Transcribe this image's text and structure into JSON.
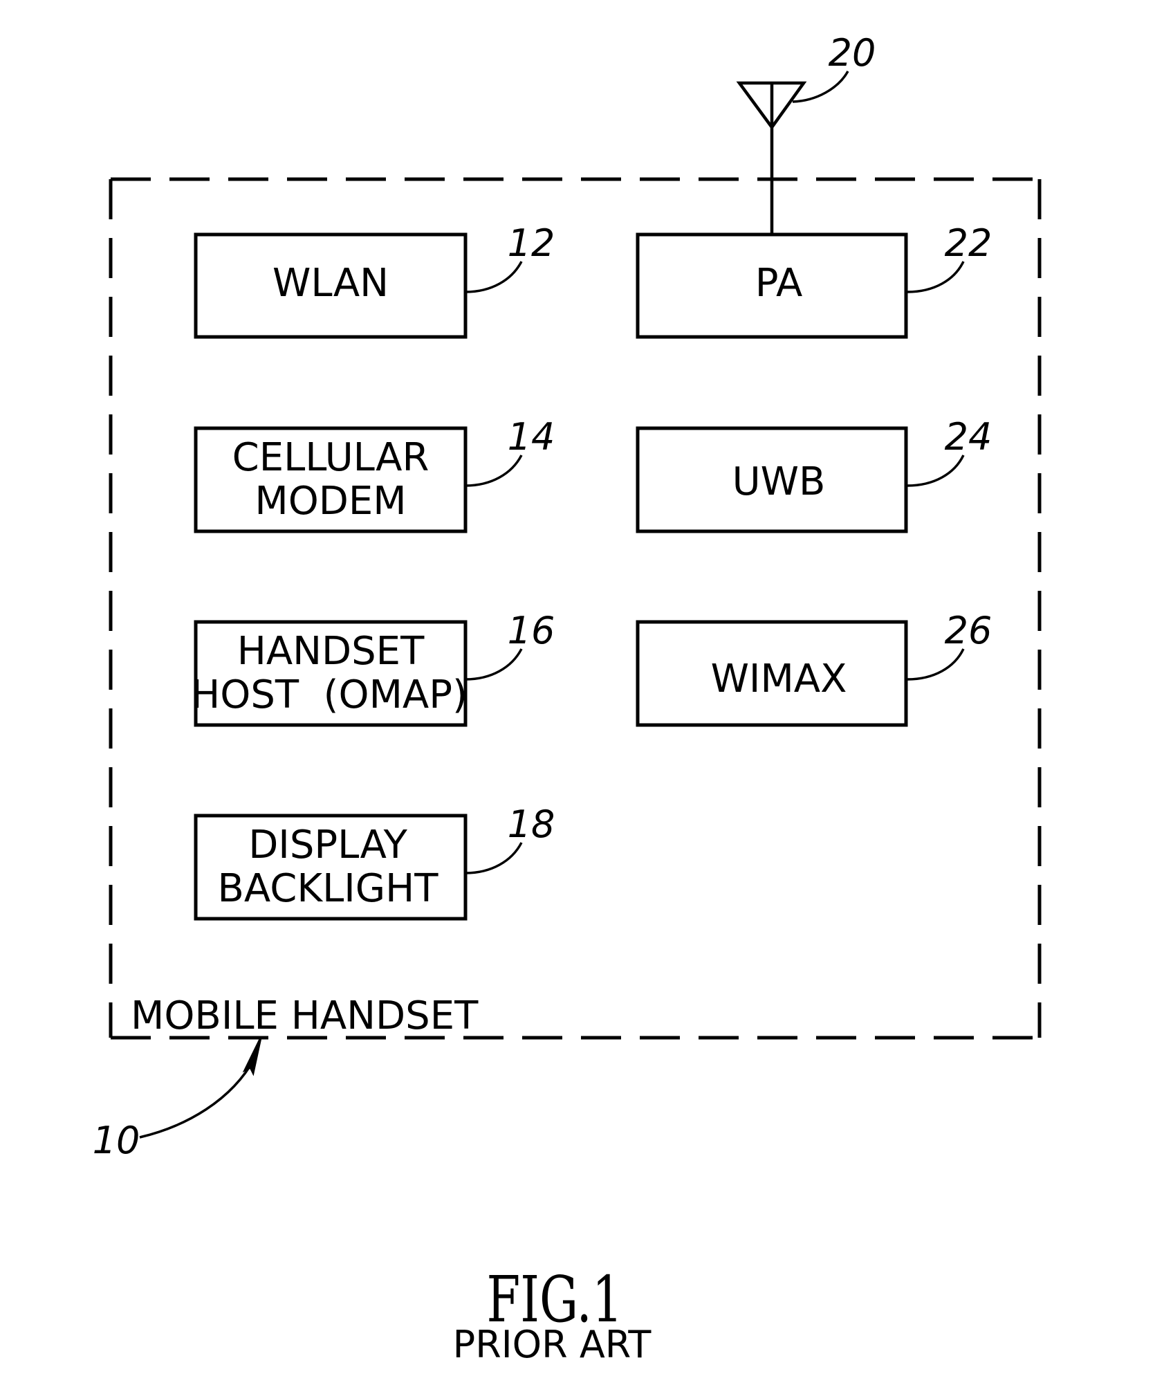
{
  "figure": {
    "title": "FIG.1",
    "subtitle": "PRIOR ART"
  },
  "device": {
    "label": "MOBILE HANDSET",
    "ref": "10"
  },
  "antenna": {
    "ref": "20"
  },
  "blocks": [
    {
      "id": "wlan",
      "lines": [
        "WLAN"
      ],
      "ref": "12"
    },
    {
      "id": "cellular-modem",
      "lines": [
        "CELLULAR",
        "MODEM"
      ],
      "ref": "14"
    },
    {
      "id": "handset-host",
      "lines": [
        "HANDSET",
        "HOST  (OMAP)"
      ],
      "ref": "16"
    },
    {
      "id": "display-backlight",
      "lines": [
        "DISPLAY",
        "BACKLIGHT"
      ],
      "ref": "18"
    },
    {
      "id": "pa",
      "lines": [
        "PA"
      ],
      "ref": "22"
    },
    {
      "id": "uwb",
      "lines": [
        "UWB"
      ],
      "ref": "24"
    },
    {
      "id": "wimax",
      "lines": [
        "WIMAX"
      ],
      "ref": "26"
    }
  ]
}
